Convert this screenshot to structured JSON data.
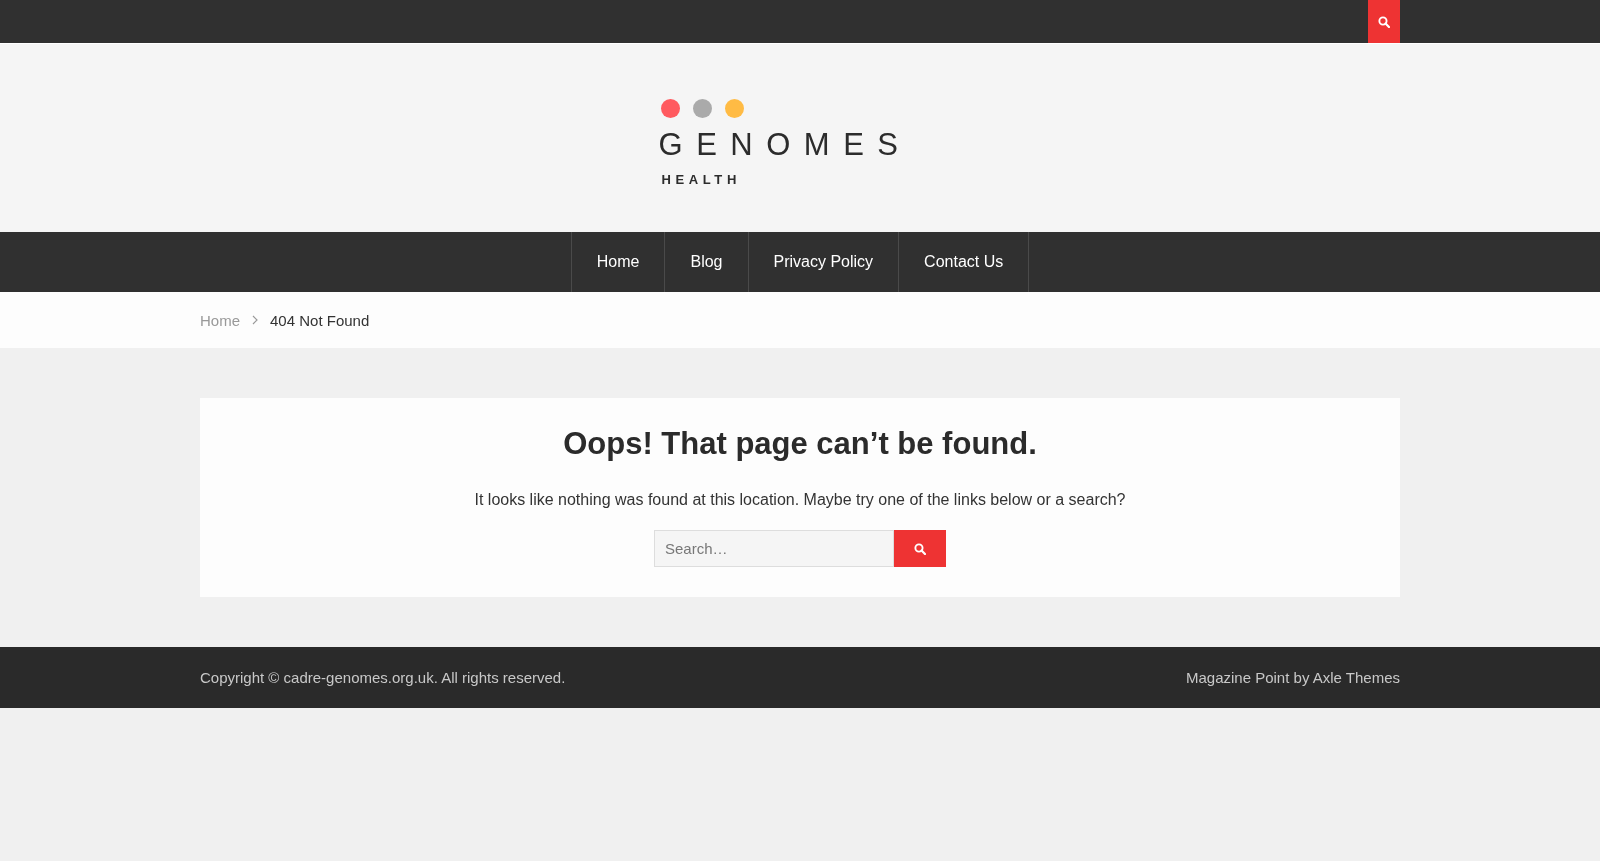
{
  "header": {
    "logo": {
      "wordmark": "GENOMES",
      "tagline": "HEALTH"
    }
  },
  "nav": {
    "items": [
      {
        "label": "Home"
      },
      {
        "label": "Blog"
      },
      {
        "label": "Privacy Policy"
      },
      {
        "label": "Contact Us"
      }
    ]
  },
  "breadcrumb": [
    {
      "label": "Home",
      "kind": "link"
    },
    {
      "label": "404 Not Found",
      "kind": "current"
    }
  ],
  "error": {
    "title": "Oops! That page can’t be found.",
    "message": "It looks like nothing was found at this location. Maybe try one of the links below or a search?",
    "search": {
      "placeholder": "Search…"
    }
  },
  "footer": {
    "copyright": "Copyright © cadre-genomes.org.uk. All rights reserved.",
    "credit": "Magazine Point by Axle Themes"
  }
}
